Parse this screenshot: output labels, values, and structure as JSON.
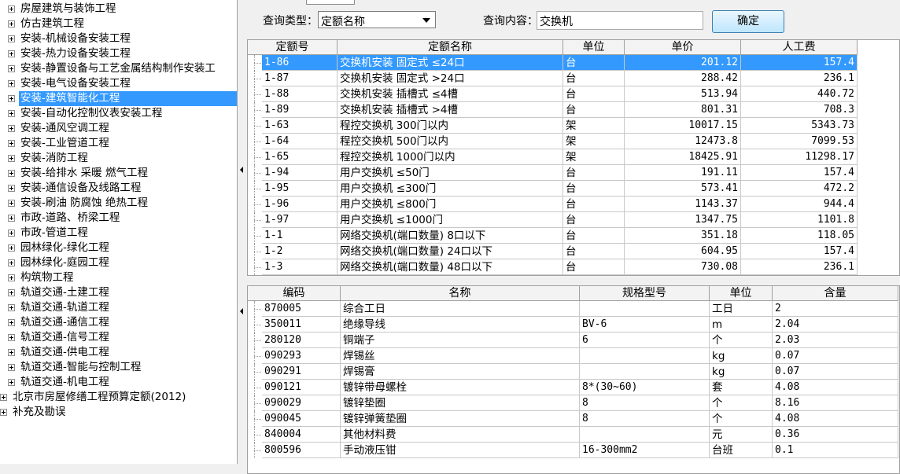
{
  "tree": {
    "items": [
      {
        "label": "房屋建筑与装饰工程",
        "expander": true,
        "selected": false,
        "level": 1
      },
      {
        "label": "仿古建筑工程",
        "expander": true,
        "selected": false,
        "level": 1
      },
      {
        "label": "安装-机械设备安装工程",
        "expander": true,
        "selected": false,
        "level": 1
      },
      {
        "label": "安装-热力设备安装工程",
        "expander": true,
        "selected": false,
        "level": 1
      },
      {
        "label": "安装-静置设备与工艺金属结构制作安装工",
        "expander": true,
        "selected": false,
        "level": 1
      },
      {
        "label": "安装-电气设备安装工程",
        "expander": true,
        "selected": false,
        "level": 1
      },
      {
        "label": "安装-建筑智能化工程",
        "expander": true,
        "selected": true,
        "level": 1
      },
      {
        "label": "安装-自动化控制仪表安装工程",
        "expander": true,
        "selected": false,
        "level": 1
      },
      {
        "label": "安装-通风空调工程",
        "expander": true,
        "selected": false,
        "level": 1
      },
      {
        "label": "安装-工业管道工程",
        "expander": true,
        "selected": false,
        "level": 1
      },
      {
        "label": "安装-消防工程",
        "expander": true,
        "selected": false,
        "level": 1
      },
      {
        "label": "安装-给排水 采暖 燃气工程",
        "expander": true,
        "selected": false,
        "level": 1
      },
      {
        "label": "安装-通信设备及线路工程",
        "expander": true,
        "selected": false,
        "level": 1
      },
      {
        "label": "安装-刷油 防腐蚀 绝热工程",
        "expander": true,
        "selected": false,
        "level": 1
      },
      {
        "label": "市政-道路、桥梁工程",
        "expander": true,
        "selected": false,
        "level": 1
      },
      {
        "label": "市政-管道工程",
        "expander": true,
        "selected": false,
        "level": 1
      },
      {
        "label": "园林绿化-绿化工程",
        "expander": true,
        "selected": false,
        "level": 1
      },
      {
        "label": "园林绿化-庭园工程",
        "expander": true,
        "selected": false,
        "level": 1
      },
      {
        "label": "构筑物工程",
        "expander": true,
        "selected": false,
        "level": 1
      },
      {
        "label": "轨道交通-土建工程",
        "expander": true,
        "selected": false,
        "level": 1
      },
      {
        "label": "轨道交通-轨道工程",
        "expander": true,
        "selected": false,
        "level": 1
      },
      {
        "label": "轨道交通-通信工程",
        "expander": true,
        "selected": false,
        "level": 1
      },
      {
        "label": "轨道交通-信号工程",
        "expander": true,
        "selected": false,
        "level": 1
      },
      {
        "label": "轨道交通-供电工程",
        "expander": true,
        "selected": false,
        "level": 1
      },
      {
        "label": "轨道交通-智能与控制工程",
        "expander": true,
        "selected": false,
        "level": 1
      },
      {
        "label": "轨道交通-机电工程",
        "expander": true,
        "selected": false,
        "level": 1
      },
      {
        "label": "北京市房屋修缮工程预算定额(2012)",
        "expander": true,
        "selected": false,
        "level": 0
      },
      {
        "label": "补充及勘误",
        "expander": true,
        "selected": false,
        "level": 0
      }
    ]
  },
  "query": {
    "type_label": "查询类型：",
    "type_value": "定额名称",
    "content_label": "查询内容：",
    "content_value": "交换机",
    "ok_button": "确定"
  },
  "quota_table": {
    "headers": [
      "定额号",
      "定额名称",
      "单位",
      "单价",
      "人工费"
    ],
    "selected_index": 0,
    "rows": [
      [
        "1-86",
        "交换机安装 固定式 ≤24口",
        "台",
        "201.12",
        "157.4"
      ],
      [
        "1-87",
        "交换机安装 固定式 >24口",
        "台",
        "288.42",
        "236.1"
      ],
      [
        "1-88",
        "交换机安装 插槽式 ≤4槽",
        "台",
        "513.94",
        "440.72"
      ],
      [
        "1-89",
        "交换机安装 插槽式 >4槽",
        "台",
        "801.31",
        "708.3"
      ],
      [
        "1-63",
        "程控交换机 300门以内",
        "架",
        "10017.15",
        "5343.73"
      ],
      [
        "1-64",
        "程控交换机 500门以内",
        "架",
        "12473.8",
        "7099.53"
      ],
      [
        "1-65",
        "程控交换机 1000门以内",
        "架",
        "18425.91",
        "11298.17"
      ],
      [
        "1-94",
        "用户交换机 ≤50门",
        "台",
        "191.11",
        "157.4"
      ],
      [
        "1-95",
        "用户交换机 ≤300门",
        "台",
        "573.41",
        "472.2"
      ],
      [
        "1-96",
        "用户交换机 ≤800门",
        "台",
        "1143.37",
        "944.4"
      ],
      [
        "1-97",
        "用户交换机 ≤1000门",
        "台",
        "1347.75",
        "1101.8"
      ],
      [
        "1-1",
        "网络交换机(端口数量) 8口以下",
        "台",
        "351.18",
        "118.05"
      ],
      [
        "1-2",
        "网络交换机(端口数量) 24口以下",
        "台",
        "604.95",
        "157.4"
      ],
      [
        "1-3",
        "网络交换机(端口数量) 48口以下",
        "台",
        "730.08",
        "236.1"
      ]
    ]
  },
  "material_table": {
    "headers": [
      "编码",
      "名称",
      "规格型号",
      "单位",
      "含量"
    ],
    "rows": [
      [
        "870005",
        "综合工日",
        "",
        "工日",
        "2"
      ],
      [
        "350011",
        "绝缘导线",
        "BV-6",
        "m",
        "2.04"
      ],
      [
        "280120",
        "铜端子",
        "6",
        "个",
        "2.03"
      ],
      [
        "090293",
        "焊锡丝",
        "",
        "kg",
        "0.07"
      ],
      [
        "090291",
        "焊锡膏",
        "",
        "kg",
        "0.07"
      ],
      [
        "090121",
        "镀锌带母螺栓",
        "8*(30~60)",
        "套",
        "4.08"
      ],
      [
        "090029",
        "镀锌垫圈",
        "8",
        "个",
        "8.16"
      ],
      [
        "090045",
        "镀锌弹簧垫圈",
        "8",
        "个",
        "4.08"
      ],
      [
        "840004",
        "其他材料费",
        "",
        "元",
        "0.36"
      ],
      [
        "800596",
        "手动液压钳",
        "16-300mm2",
        "台班",
        "0.1"
      ]
    ]
  }
}
